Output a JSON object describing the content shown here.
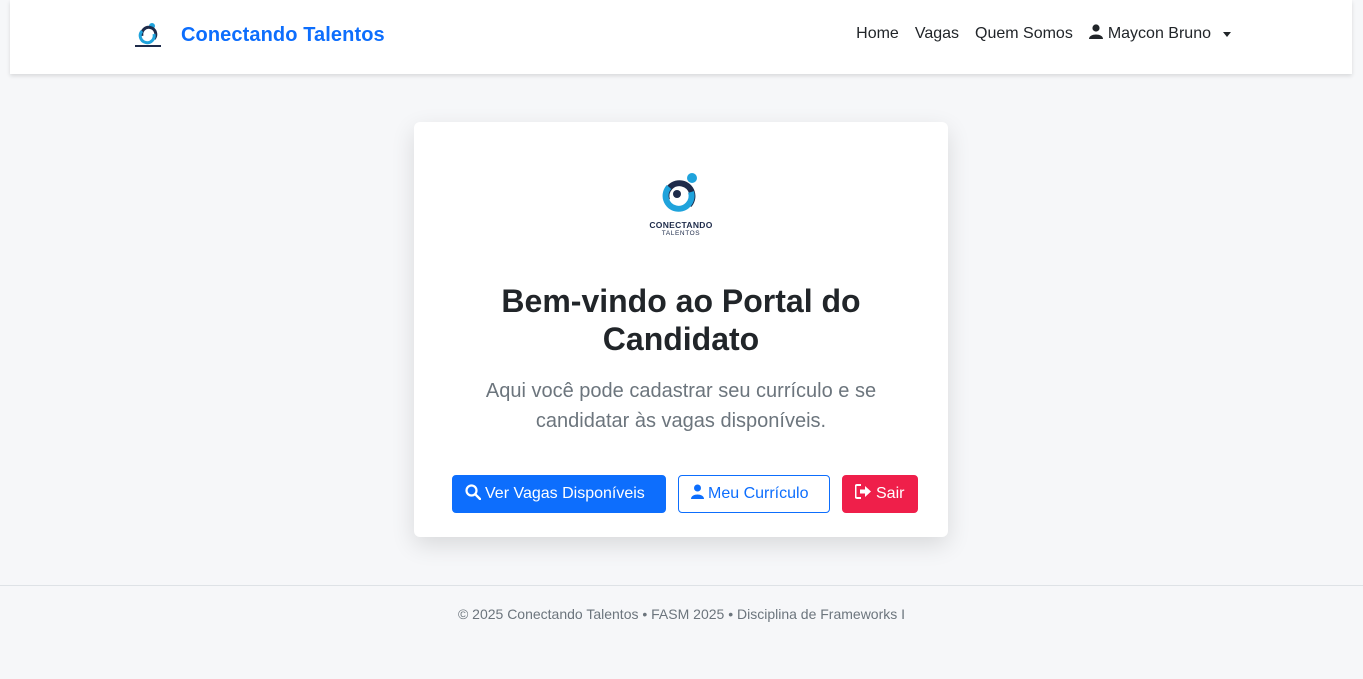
{
  "navbar": {
    "brand": "Conectando Talentos",
    "links": [
      "Home",
      "Vagas",
      "Quem Somos"
    ],
    "user": "Maycon Bruno"
  },
  "card": {
    "logo_caption": "CONECTANDO",
    "logo_sub": "TALENTOS",
    "title": "Bem-vindo ao Portal do Candidato",
    "subtitle": "Aqui você pode cadastrar seu currículo e se candidatar às vagas disponíveis.",
    "buttons": {
      "vagas": "Ver Vagas Disponíveis",
      "curriculo": "Meu Currículo",
      "sair": "Sair"
    }
  },
  "footer": {
    "text": "© 2025 Conectando Talentos • FASM 2025 • Disciplina de Frameworks I"
  },
  "colors": {
    "primary": "#0d6efd",
    "danger": "#ef1f4a",
    "muted": "#6c757d",
    "logo_dark": "#1e2b4a",
    "logo_light": "#1fa3dc"
  },
  "icons": {
    "user": "user-icon",
    "search": "search-icon",
    "signout": "sign-out-icon",
    "caret": "caret-down-icon"
  }
}
